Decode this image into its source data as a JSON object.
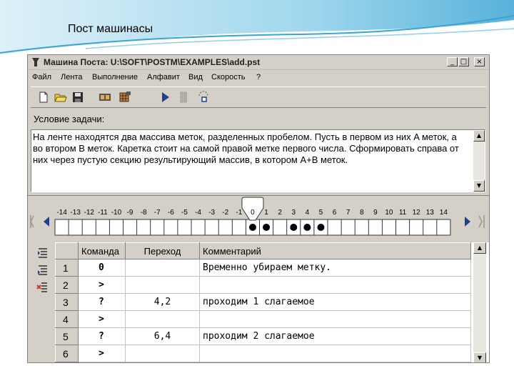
{
  "slide": {
    "title": "Пост машинасы"
  },
  "window": {
    "title": "Машина Поста: U:\\SOFT\\POSTM\\EXAMPLES\\add.pst",
    "controls": {
      "minimize": "_",
      "maximize": "□",
      "close": "×"
    }
  },
  "menu": [
    "Файл",
    "Лента",
    "Выполнение",
    "Алфавит",
    "Вид",
    "Скорость",
    "?"
  ],
  "toolbar": {
    "icons": [
      "new-file-icon",
      "open-folder-icon",
      "save-icon",
      "film-icon",
      "film-grid-icon",
      "run-icon",
      "pause-icon",
      "step-icon"
    ]
  },
  "condition": {
    "label": "Условие задачи:",
    "text": "На ленте находятся два массива меток, разделенных пробелом. Пусть в первом из них A меток, а во втором B меток.  Каретка стоит на самой правой метке первого числа. Сформировать справа от них через пустую секцию результирующий массив, в котором A+B меток."
  },
  "tape": {
    "positions": [
      -14,
      -13,
      -12,
      -11,
      -10,
      -9,
      -8,
      -7,
      -6,
      -5,
      -4,
      -3,
      -2,
      -1,
      0,
      1,
      2,
      3,
      4,
      5,
      6,
      7,
      8,
      9,
      10,
      11,
      12,
      13,
      14
    ],
    "marked": [
      0,
      1,
      3,
      4,
      5
    ],
    "carriage": 0
  },
  "program": {
    "columns": [
      "Команда",
      "Переход",
      "Комментарий"
    ],
    "rows": [
      {
        "n": "1",
        "cmd": "0",
        "jump": "",
        "comment": "Временно убираем метку."
      },
      {
        "n": "2",
        "cmd": ">",
        "jump": "",
        "comment": ""
      },
      {
        "n": "3",
        "cmd": "?",
        "jump": "4,2",
        "comment": "проходим 1 слагаемое"
      },
      {
        "n": "4",
        "cmd": ">",
        "jump": "",
        "comment": ""
      },
      {
        "n": "5",
        "cmd": "?",
        "jump": "6,4",
        "comment": "проходим 2 слагаемое"
      },
      {
        "n": "6",
        "cmd": ">",
        "jump": "",
        "comment": ""
      }
    ]
  },
  "sideicons": [
    "insert-row-icon",
    "append-row-icon",
    "delete-row-icon"
  ],
  "colors": {
    "window_bg": "#d4d0c8",
    "swoosh": "#5fb6d8",
    "run": "#1f3f8f"
  }
}
